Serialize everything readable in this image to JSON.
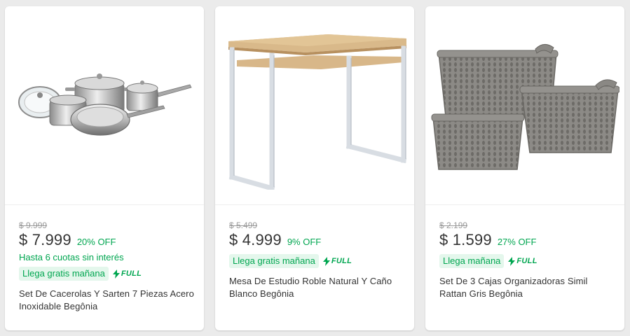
{
  "products": [
    {
      "image": "cookware-set-icon",
      "old_price": "$ 9.999",
      "price": "$ 7.999",
      "discount": "20% OFF",
      "installments": "Hasta 6 cuotas sin interés",
      "shipping": "Llega gratis mañana",
      "fulfillment": "FULL",
      "title": "Set De Cacerolas Y Sarten 7 Piezas Acero Inoxidable Begônia"
    },
    {
      "image": "desk-icon",
      "old_price": "$ 5.499",
      "price": "$ 4.999",
      "discount": "9% OFF",
      "shipping": "Llega gratis mañana",
      "fulfillment": "FULL",
      "title": "Mesa De Estudio Roble Natural Y Caño Blanco Begônia"
    },
    {
      "image": "baskets-icon",
      "old_price": "$ 2.199",
      "price": "$ 1.599",
      "discount": "27% OFF",
      "shipping": "Llega mañana",
      "fulfillment": "FULL",
      "title": "Set De 3 Cajas Organizadoras Simil Rattan Gris Begônia"
    }
  ],
  "colors": {
    "accent_green": "#00a650",
    "badge_bg": "#e4f7ec",
    "page_bg": "#ebebeb",
    "card_bg": "#ffffff",
    "text": "#333333",
    "muted": "#999999"
  }
}
